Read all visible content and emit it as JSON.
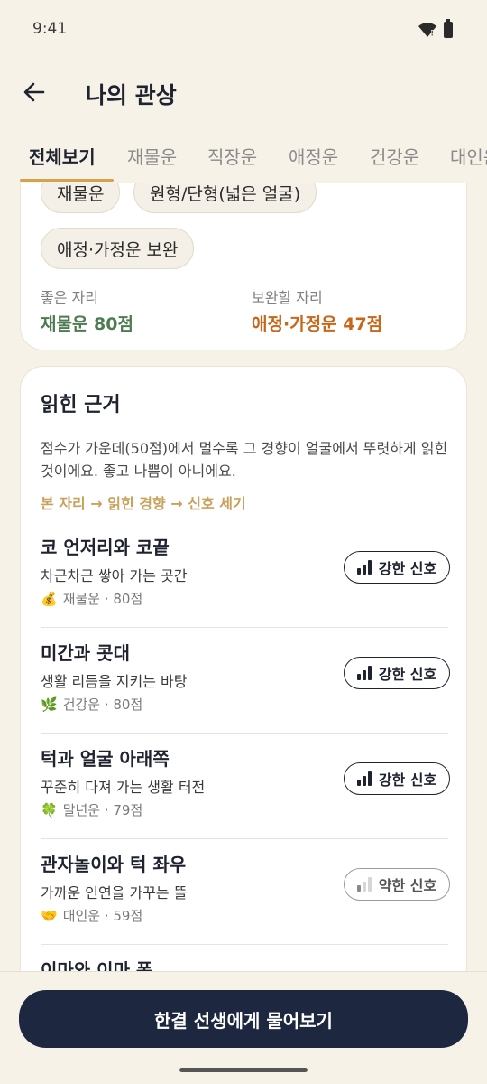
{
  "status": {
    "time": "9:41"
  },
  "header": {
    "title": "나의 관상"
  },
  "tabs": [
    "전체보기",
    "재물운",
    "직장운",
    "애정운",
    "건강운",
    "대인운"
  ],
  "summary": {
    "chips": [
      "재물운",
      "원형/단형(넓은 얼굴)",
      "애정·가정운 보완"
    ],
    "good_label": "좋은 자리",
    "good_value": "재물운 80점",
    "weak_label": "보완할 자리",
    "weak_value": "애정·가정운 47점"
  },
  "evidence": {
    "title": "읽힌 근거",
    "description": "점수가 가운데(50점)에서 멀수록 그 경향이 얼굴에서 뚜렷하게 읽힌 것이에요. 좋고 나쁨이 아니에요.",
    "flow": "본 자리 → 읽힌 경향 → 신호 세기",
    "items": [
      {
        "title": "코 언저리와 코끝",
        "subtitle": "차근차근 쌓아 가는 곳간",
        "emoji": "💰",
        "meta": "재물운 · 80점",
        "signal": "강한 신호",
        "signal_level": "strong"
      },
      {
        "title": "미간과 콧대",
        "subtitle": "생활 리듬을 지키는 바탕",
        "emoji": "🌿",
        "meta": "건강운 · 80점",
        "signal": "강한 신호",
        "signal_level": "strong"
      },
      {
        "title": "턱과 얼굴 아래쪽",
        "subtitle": "꾸준히 다져 가는 생활 터전",
        "emoji": "🍀",
        "meta": "말년운 · 79점",
        "signal": "강한 신호",
        "signal_level": "strong"
      },
      {
        "title": "관자놀이와 턱 좌우",
        "subtitle": "가까운 인연을 가꾸는 뜰",
        "emoji": "🤝",
        "meta": "대인운 · 59점",
        "signal": "약한 신호",
        "signal_level": "weak"
      },
      {
        "title": "이마와 이마 폭",
        "subtitle": "",
        "emoji": "",
        "meta": "",
        "signal": "",
        "signal_level": ""
      }
    ]
  },
  "cta": {
    "label": "한결 선생에게 물어보기"
  },
  "colors": {
    "accent": "#D3A24E",
    "good": "#4E7B52",
    "warn": "#C8671A",
    "cta_bg": "#1E2740",
    "background": "#F7F2E8"
  }
}
